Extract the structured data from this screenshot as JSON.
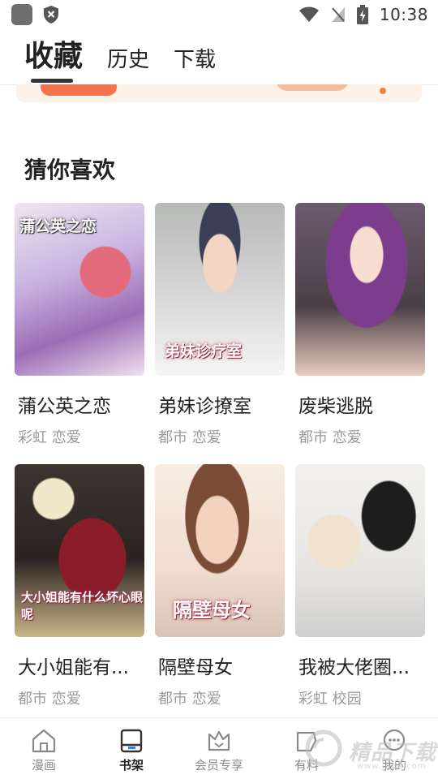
{
  "status_bar": {
    "time": "10:38"
  },
  "tabs": [
    {
      "label": "收藏",
      "active": true
    },
    {
      "label": "历史",
      "active": false
    },
    {
      "label": "下载",
      "active": false
    }
  ],
  "section": {
    "title": "猜你喜欢"
  },
  "comics": [
    {
      "title": "蒲公英之恋",
      "tags": "彩虹 恋爱",
      "cover_text": "蒲公英之恋",
      "cover_text_pos": "top"
    },
    {
      "title": "弟妹诊撩室",
      "tags": "都市 恋爱",
      "cover_text": "弟妹诊疗室",
      "cover_text_pos": "bottom"
    },
    {
      "title": "废柴逃脱",
      "tags": "都市 恋爱",
      "cover_text": "",
      "cover_text_pos": "none"
    },
    {
      "title": "大小姐能有...",
      "tags": "都市 恋爱",
      "cover_text": "大小姐能有什么坏心眼呢",
      "cover_text_pos": "bottom"
    },
    {
      "title": "隔壁母女",
      "tags": "都市 恋爱",
      "cover_text": "隔壁母女",
      "cover_text_pos": "bottom"
    },
    {
      "title": "我被大佬圈...",
      "tags": "彩虹 校园",
      "cover_text": "",
      "cover_text_pos": "none"
    }
  ],
  "bottom_nav": [
    {
      "label": "漫画",
      "icon": "home-icon",
      "active": false
    },
    {
      "label": "书架",
      "icon": "bookshelf-icon",
      "active": true
    },
    {
      "label": "会员专享",
      "icon": "vip-crown-icon",
      "active": false
    },
    {
      "label": "有料",
      "icon": "feed-icon",
      "active": false
    },
    {
      "label": "我的",
      "icon": "profile-icon",
      "active": false
    }
  ],
  "watermark": {
    "text": "精品下载",
    "sub": "www.jpxw.com"
  },
  "colors": {
    "accent": "#f2744d",
    "tag_gray": "#9a9a9a",
    "text": "#222222"
  }
}
